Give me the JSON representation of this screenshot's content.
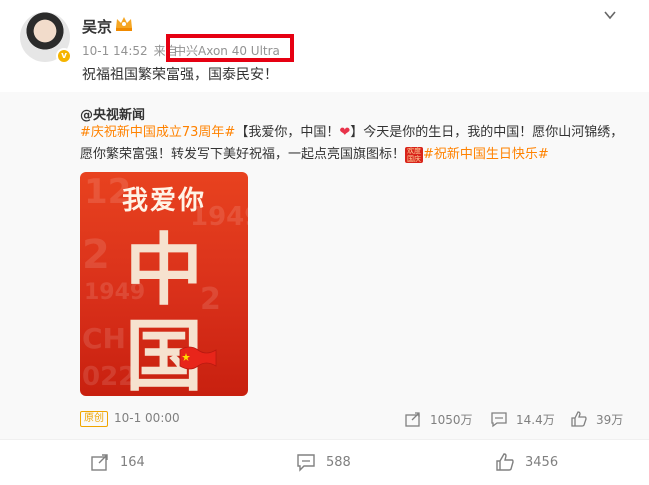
{
  "post": {
    "username": "吴京",
    "timestamp": "10-1 14:52",
    "source_prefix": "来自",
    "device": "中兴Axon 40 Ultra",
    "text": "祝福祖国繁荣富强，国泰民安！"
  },
  "repost": {
    "author": "@央视新闻",
    "hashtag1": "#庆祝新中国成立73周年#",
    "text_a": "【我爱你，中国！",
    "text_b": "】今天是你的生日，我的中国！愿你山河锦绣，愿你繁荣富强！转发写下美好祝福，一起点亮国旗图标！",
    "hashtag2": "#祝新中国生日快乐#",
    "badge_text": "欢度国庆",
    "poster": {
      "line1": "我爱你",
      "big1": "中",
      "big2": "国"
    },
    "footer": {
      "orig_badge": "原创",
      "time": "10-1 00:00",
      "reposts": "1050万",
      "comments": "14.4万",
      "likes": "39万"
    }
  },
  "actions": {
    "reposts": "164",
    "comments": "588",
    "likes": "3456"
  },
  "colors": {
    "hashtag": "#ff8200",
    "highlight": "#e60012",
    "verified": "#f5b400"
  }
}
